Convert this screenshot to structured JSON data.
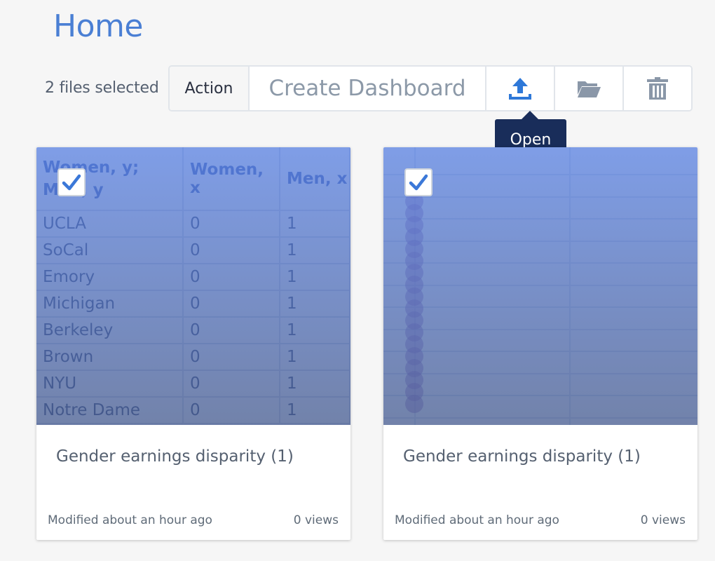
{
  "page": {
    "title": "Home"
  },
  "selection": {
    "count_label": "2 files selected"
  },
  "toolbar": {
    "action_label": "Action",
    "create_label": "Create Dashboard",
    "open_icon": "upload-icon",
    "move_icon": "folder-icon",
    "delete_icon": "trash-icon"
  },
  "tooltip": {
    "text": "Open"
  },
  "colors": {
    "accent": "#4a7fd4",
    "tooltip_bg": "#192d5a",
    "selection_overlay": "#5b82e0"
  },
  "files": [
    {
      "title": "Gender earnings disparity (1)",
      "modified": "Modified about an hour ago",
      "views": "0 views",
      "selected": true,
      "preview": {
        "type": "table",
        "headers": [
          "Women, y; Men, y",
          "Women, x",
          "Men, x"
        ],
        "rows": [
          [
            "UCLA",
            "0",
            "1"
          ],
          [
            "SoCal",
            "0",
            "1"
          ],
          [
            "Emory",
            "0",
            "1"
          ],
          [
            "Michigan",
            "0",
            "1"
          ],
          [
            "Berkeley",
            "0",
            "1"
          ],
          [
            "Brown",
            "0",
            "1"
          ],
          [
            "NYU",
            "0",
            "1"
          ],
          [
            "Notre Dame",
            "0",
            "1"
          ]
        ]
      }
    },
    {
      "title": "Gender earnings disparity (1)",
      "modified": "Modified about an hour ago",
      "views": "0 views",
      "selected": true,
      "preview": {
        "type": "plot"
      }
    }
  ]
}
